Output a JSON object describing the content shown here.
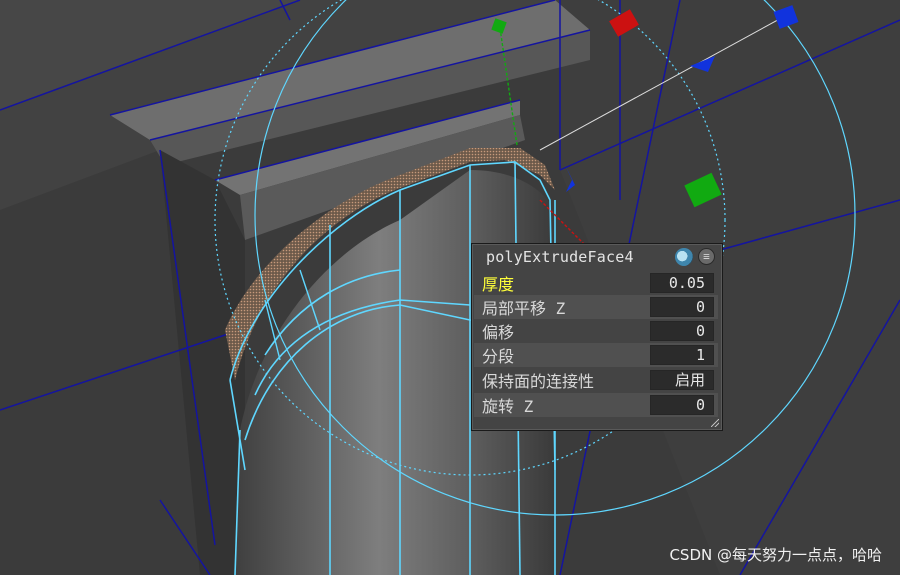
{
  "in_view_editor": {
    "node_name": "polyExtrudeFace4",
    "rows": [
      {
        "label": "厚度",
        "value": "0.05",
        "highlight": true
      },
      {
        "label": "局部平移 Z",
        "value": "0"
      },
      {
        "label": "偏移",
        "value": "0"
      },
      {
        "label": "分段",
        "value": "1"
      },
      {
        "label": "保持面的连接性",
        "value": "启用"
      },
      {
        "label": "旋转 Z",
        "value": "0"
      }
    ],
    "icons": [
      "display-mode-sphere-icon",
      "menu-icon"
    ]
  },
  "watermark": "CSDN @每天努力一点点，哈哈",
  "colors": {
    "viewport_bg": "#3b3b3b",
    "wireframe_selected": "#5fd7ff",
    "wireframe_edges": "#1414a0",
    "manip_x": "#cc1111",
    "manip_y": "#11aa11",
    "manip_z": "#1133dd",
    "label_highlight": "#ffff3a"
  }
}
